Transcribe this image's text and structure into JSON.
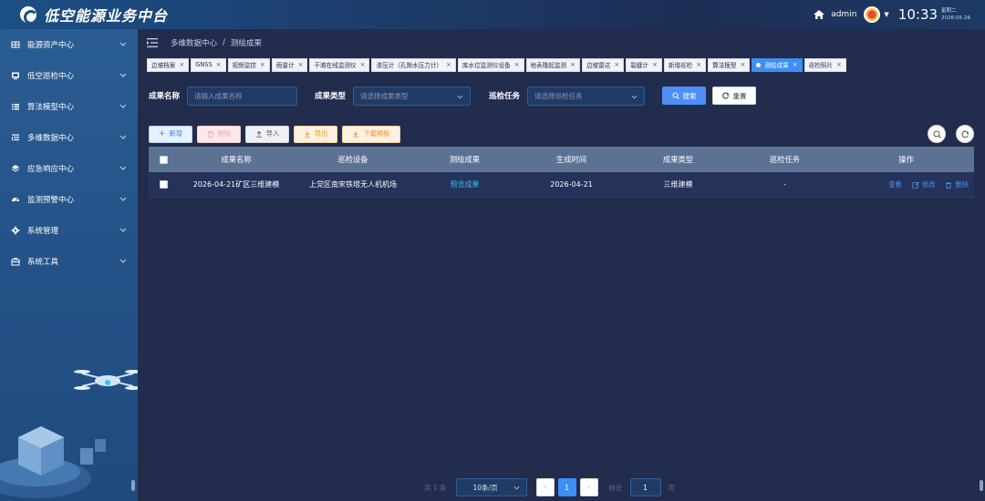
{
  "header": {
    "app_title": "低空能源业务中台",
    "username": "admin",
    "time": "10:33",
    "weekday": "星期二",
    "date": "2026-05-26"
  },
  "sidebar": {
    "items": [
      {
        "label": "能源资产中心",
        "icon": "grid-icon"
      },
      {
        "label": "低空巡检中心",
        "icon": "monitor-icon"
      },
      {
        "label": "算法模型中心",
        "icon": "list-icon"
      },
      {
        "label": "多维数据中心",
        "icon": "data-list-icon"
      },
      {
        "label": "应急响应中心",
        "icon": "layers-icon"
      },
      {
        "label": "监测预警中心",
        "icon": "dashboard-icon"
      },
      {
        "label": "系统管理",
        "icon": "gear-icon"
      },
      {
        "label": "系统工具",
        "icon": "toolbox-icon"
      }
    ]
  },
  "breadcrumb": {
    "parent": "多维数据中心",
    "separator": "/",
    "current": "测绘成果"
  },
  "tags": [
    {
      "label": "边坡档案",
      "active": false
    },
    {
      "label": "GNSS",
      "active": false
    },
    {
      "label": "视频监控",
      "active": false
    },
    {
      "label": "雨量计",
      "active": false
    },
    {
      "label": "干滩在线监测仪",
      "active": false
    },
    {
      "label": "渗压计（孔隙水压力计）",
      "active": false
    },
    {
      "label": "库水位监测仪设备",
      "active": false
    },
    {
      "label": "地表隆起监测",
      "active": false
    },
    {
      "label": "边坡雷达",
      "active": false
    },
    {
      "label": "裂缝计",
      "active": false
    },
    {
      "label": "新增巡检",
      "active": false
    },
    {
      "label": "算法模型",
      "active": false
    },
    {
      "label": "测绘成果",
      "active": true
    },
    {
      "label": "巡检照片",
      "active": false
    }
  ],
  "search": {
    "name_label": "成果名称",
    "name_placeholder": "请输入成果名称",
    "type_label": "成果类型",
    "type_placeholder": "请选择成果类型",
    "task_label": "巡检任务",
    "task_placeholder": "请选择巡检任务",
    "search_btn": "搜索",
    "reset_btn": "重置"
  },
  "toolbar": {
    "add": "新增",
    "delete": "删除",
    "import": "导入",
    "export": "导出",
    "template": "下载模板"
  },
  "table": {
    "columns": [
      "成果名称",
      "巡检设备",
      "测绘成果",
      "生成时间",
      "成果类型",
      "巡检任务",
      "操作"
    ],
    "rows": [
      {
        "name": "2026-04-21矿区三维建模",
        "device": "上党区南宋铁塔无人机机场",
        "result": "预览成果",
        "time": "2026-04-21",
        "type": "三维建模",
        "task": "-",
        "ops": {
          "view": "查看",
          "edit": "修改",
          "delete": "删除"
        }
      }
    ]
  },
  "pagination": {
    "total": "共 1 条",
    "page_size": "10条/页",
    "current_page": "1",
    "goto_label": "前往",
    "goto_value": "1",
    "page_suffix": "页"
  },
  "colors": {
    "accent": "#3d8ef5",
    "sidebar": "#24548a",
    "main_bg": "#222c4c",
    "table_header": "#5c7294"
  }
}
